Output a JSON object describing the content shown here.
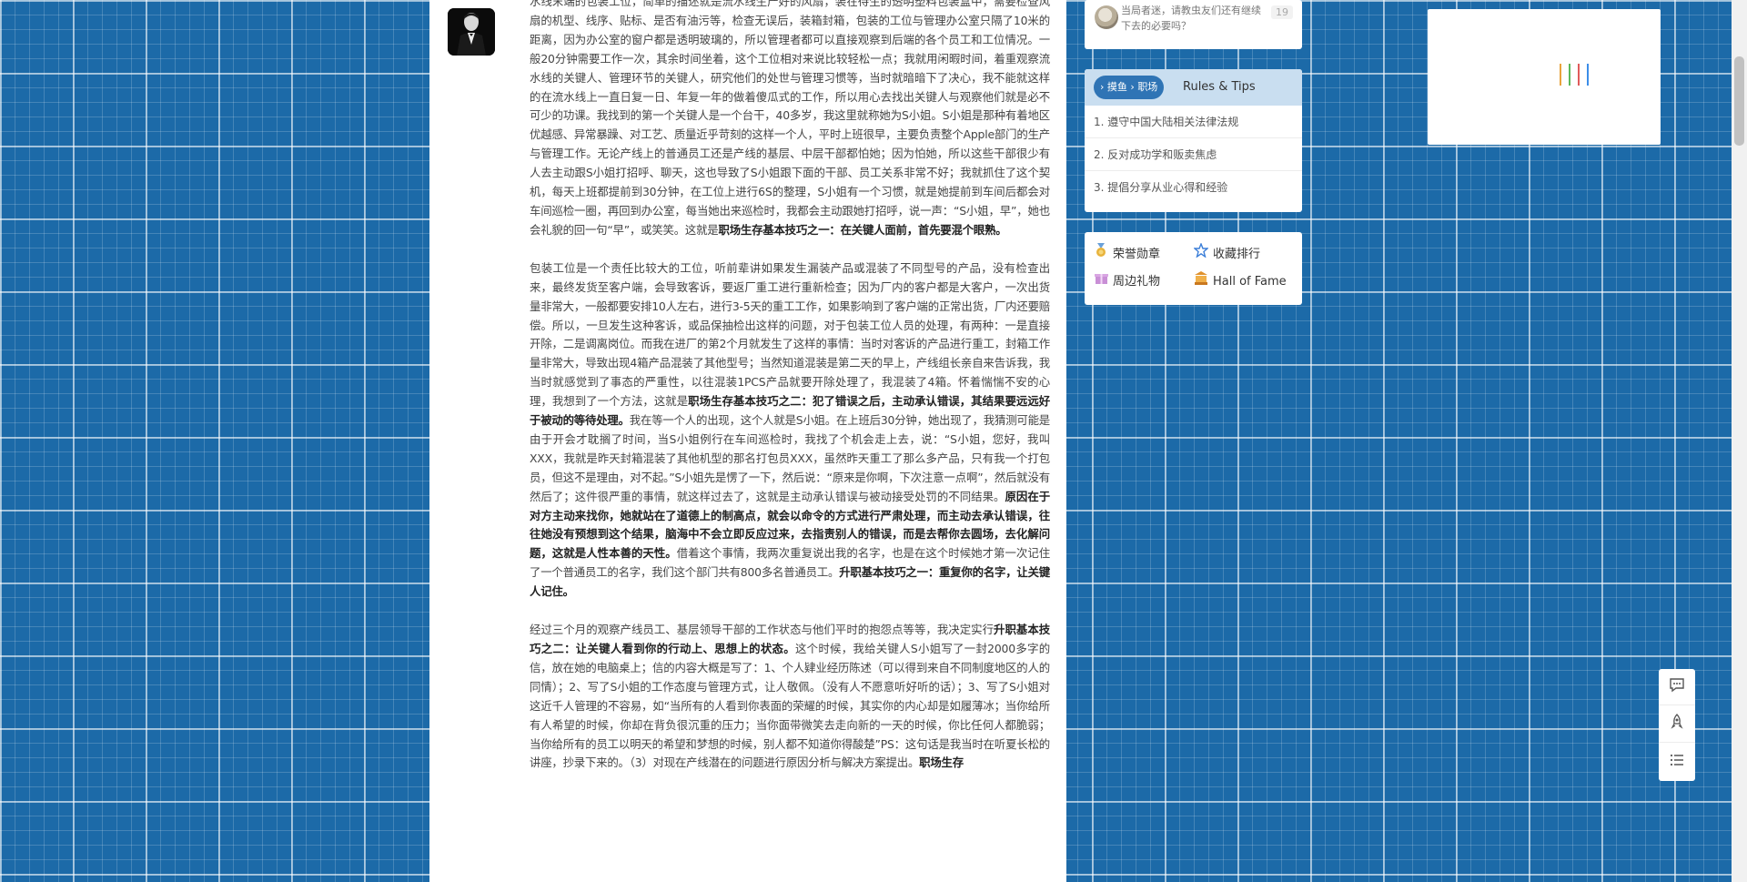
{
  "article": {
    "paragraphs": [
      [
        {
          "t": "水线末端的包装工位，简单的描述就是流水线生产好的风扇，装在待生的透明塑料包装盒中，需要检查风扇的机型、线序、贴标、是否有油污等，检查无误后，装箱封箱，包装的工位与管理办公室只隔了10米的距离，因为办公室的窗户都是透明玻璃的，所以管理者都可以直接观察到后端的各个员工和工位情况。一般20分钟需要工作一次，其余时间坐着，这个工位相对来说比较轻松一点；我就用闲暇时间，着重观察流水线的关键人、管理环节的关键人，研究他们的处世与管理习惯等，当时就暗暗下了决心，我不能就这样的在流水线上一直日复一日、年复一年的做着傻瓜式的工作，所以用心去找出关键人与观察他们就是必不可少的功课。我找到的第一个关键人是一个台干，40多岁，我这里就称她为S小姐。S小姐是那种有着地区优越感、异常暴躁、对工艺、质量近乎苛刻的这样一个人，平时上班很早，主要负责整个Apple部门的生产与管理工作。无论产线上的普通员工还是产线的基层、中层干部都怕她；因为怕她，所以这些干部很少有人去主动跟S小姐打招呼、聊天，这也导致了S小姐跟下面的干部、员工关系非常不好；我就抓住了这个契机，每天上班都提前到30分钟，在工位上进行6S的整理，S小姐有一个习惯，就是她提前到车间后都会对车间巡检一圈，再回到办公室，每当她出来巡检时，我都会主动跟她打招呼，说一声：“S小姐，早”，她也会礼貌的回一句“早”，或笑笑。这就是",
          "b": false
        },
        {
          "t": "职场生存基本技巧之一：在关键人面前，首先要混个眼熟。",
          "b": true
        }
      ],
      [
        {
          "t": "包装工位是一个责任比较大的工位，听前辈讲如果发生漏装产品或混装了不同型号的产品，没有检查出来，最终发货至客户端，会导致客诉，要返厂重工进行重新检查；因为厂内的客户都是大客户，一次出货量非常大，一般都要安排10人左右，进行3-5天的重工工作，如果影响到了客户端的正常出货，厂内还要赔偿。所以，一旦发生这种客诉，或品保抽检出这样的问题，对于包装工位人员的处理，有两种：一是直接开除，二是调离岗位。而我在进厂的第2个月就发生了这样的事情：当时对客诉的产品进行重工，封箱工作量非常大，导致出现4箱产品混装了其他型号；当然知道混装是第二天的早上，产线组长亲自来告诉我，我当时就感觉到了事态的严重性，以往混装1PCS产品就要开除处理了，我混装了4箱。怀着惴惴不安的心理，我想到了一个方法，这就是",
          "b": false
        },
        {
          "t": "职场生存基本技巧之二：犯了错误之后，主动承认错误，其结果要远远好于被动的等待处理。",
          "b": true
        },
        {
          "t": "我在等一个人的出现，这个人就是S小姐。在上班后30分钟，她出现了，我猜测可能是由于开会才耽搁了时间，当S小姐例行在车间巡检时，我找了个机会走上去，说：“S小姐，您好，我叫XXX，我就是昨天封箱混装了其他机型的那名打包员XXX，虽然昨天重工了那么多产品，只有我一个打包员，但这不是理由，对不起。”S小姐先是愣了一下，然后说：“原来是你啊，下次注意一点啊”，然后就没有然后了；这件很严重的事情，就这样过去了，这就是主动承认错误与被动接受处罚的不同结果。",
          "b": false
        },
        {
          "t": "原因在于对方主动来找你，她就站在了道德上的制高点，就会以命令的方式进行严肃处理，而主动去承认错误，往往她没有预想到这个结果，脑海中不会立即反应过来，去指责别人的错误，而是去帮你去圆场，去化解问题，这就是人性本善的天性。",
          "b": true
        },
        {
          "t": "借着这个事情，我两次重复说出我的名字，也是在这个时候她才第一次记住了一个普通员工的名字，我们这个部门共有800多名普通员工。",
          "b": false
        },
        {
          "t": "升职基本技巧之一：重复你的名字，让关键人记住。",
          "b": true
        }
      ],
      [
        {
          "t": "经过三个月的观察产线员工、基层领导干部的工作状态与他们平时的抱怨点等等，我决定实行",
          "b": false
        },
        {
          "t": "升职基本技巧之二：让关键人看到你的行动上、思想上的状态。",
          "b": true
        },
        {
          "t": "这个时候，我给关键人S小姐写了一封2000多字的信，放在她的电脑桌上；信的内容大概是写了：1、个人肄业经历陈述（可以得到来自不同制度地区的人的同情）；2、写了S小姐的工作态度与管理方式，让人敬佩。（没有人不愿意听好听的话）；3、写了S小姐对这近千人管理的不容易，如“当所有的人看到你表面的荣耀的时候，其实你的内心却是如履薄冰；当你给所有人希望的时候，你却在背负很沉重的压力；当你面带微笑去走向新的一天的时候，你比任何人都脆弱；当你给所有的员工以明天的希望和梦想的时候，别人都不知道你得酸楚”PS：这句话是我当时在听夏长松的讲座，抄录下来的。（3）对现在产线潜在的问题进行原因分析与解决方案提出。",
          "b": false
        },
        {
          "t": "职场生存",
          "b": true
        }
      ]
    ]
  },
  "topic": {
    "title": "当局者迷，请教虫友们还有继续下去的必要吗？",
    "count": "19"
  },
  "rules": {
    "breadcrumb": [
      "摸鱼",
      "职场"
    ],
    "title": "Rules & Tips",
    "items": [
      "1. 遵守中国大陆相关法律法规",
      "2. 反对成功学和贩卖焦虑",
      "3. 提倡分享从业心得和经验"
    ]
  },
  "links": {
    "honor": "荣誉勋章",
    "favorites": "收藏排行",
    "gifts": "周边礼物",
    "hall": "Hall of Fame"
  },
  "icons": {
    "honor": "medal-icon",
    "favorites": "star-icon",
    "gifts": "gift-icon",
    "hall": "trophy-icon",
    "comment": "comment-icon",
    "top": "rocket-icon",
    "toc": "list-icon"
  },
  "colors": {
    "background": "#1c6aa8",
    "accent": "#2f74b5",
    "rules_header": "#c9def0",
    "ad_bars": [
      "#e8a33c",
      "#5cb85c",
      "#e05a5a",
      "#3c8de8"
    ]
  }
}
